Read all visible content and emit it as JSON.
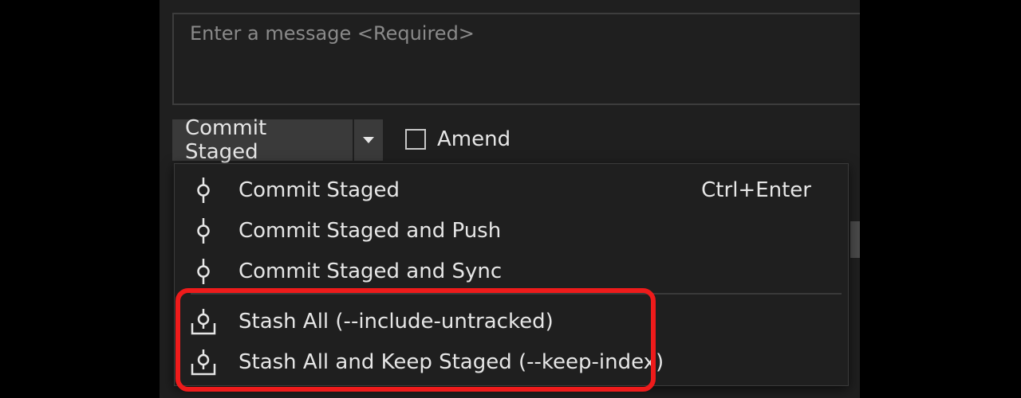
{
  "message": {
    "placeholder": "Enter a message <Required>"
  },
  "commit_button": {
    "label": "Commit Staged"
  },
  "amend": {
    "label": "Amend",
    "checked": false
  },
  "menu": {
    "items": [
      {
        "label": "Commit Staged",
        "shortcut": "Ctrl+Enter",
        "icon": "commit-icon"
      },
      {
        "label": "Commit Staged and Push",
        "shortcut": "",
        "icon": "commit-icon"
      },
      {
        "label": "Commit Staged and Sync",
        "shortcut": "",
        "icon": "commit-icon"
      },
      {
        "label": "Stash All (--include-untracked)",
        "shortcut": "",
        "icon": "stash-icon"
      },
      {
        "label": "Stash All and Keep Staged (--keep-index)",
        "shortcut": "",
        "icon": "stash-icon"
      }
    ]
  },
  "colors": {
    "panel_bg": "#1f1f1f",
    "button_bg": "#3a3a3a",
    "highlight": "#ee1b1b",
    "text": "#e6e6e6"
  }
}
